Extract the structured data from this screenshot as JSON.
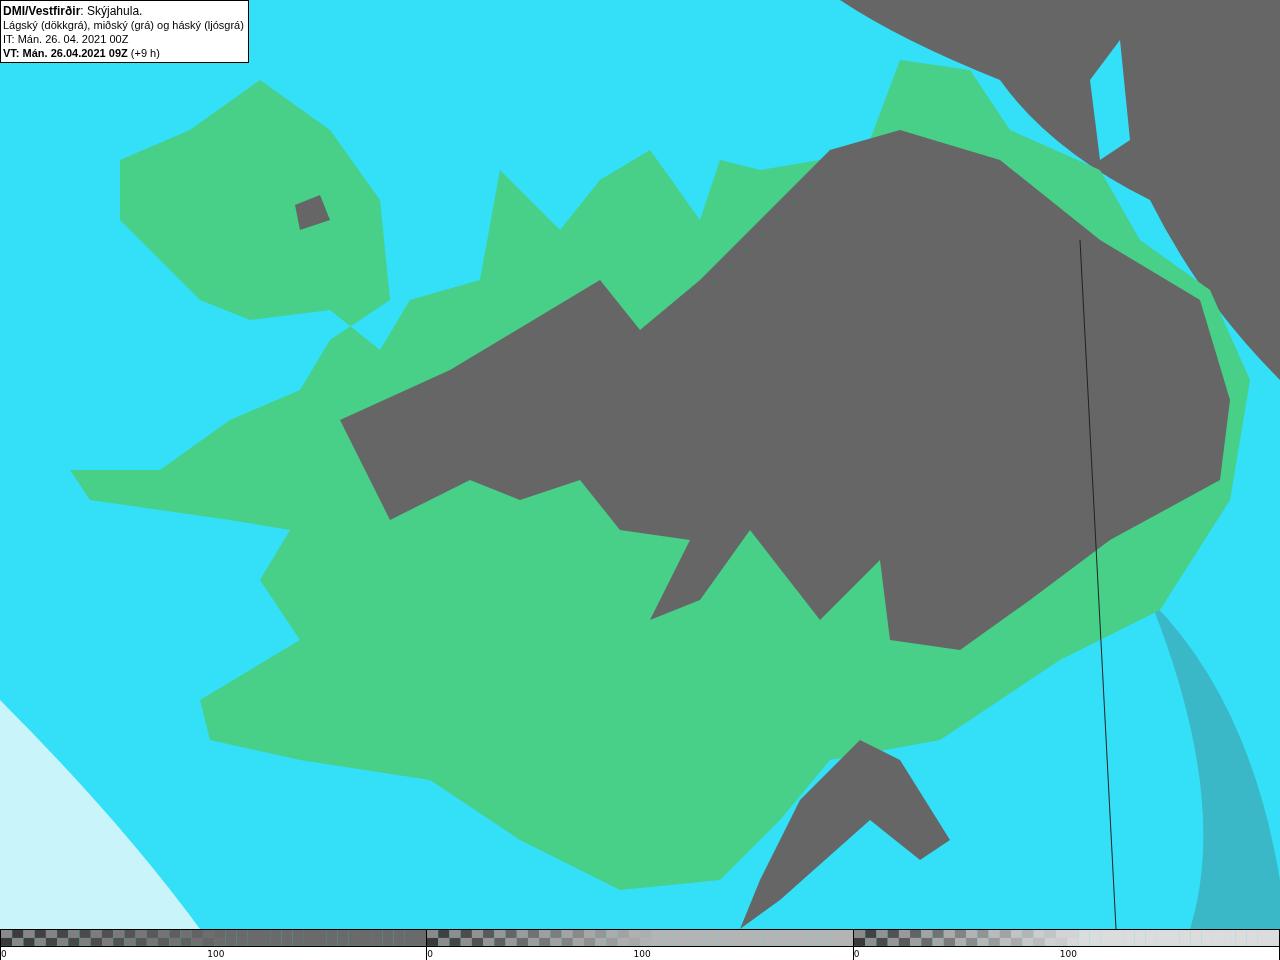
{
  "header": {
    "lines": [
      "**DMI/Vestfirðir**: Skýjahula.",
      "Lágský (dökkgrá), miðský (grá) og háský (ljósgrá)",
      "IT: Mán. 26. 04. 2021 00Z",
      "**VT: Mán. 26.04.2021 09Z** (+9 h)"
    ]
  },
  "legend": [
    {
      "color": "#6a6a6a",
      "ticks": [
        "0",
        "100"
      ]
    },
    {
      "color": "#b4b4b4",
      "ticks": [
        "0",
        "100"
      ]
    },
    {
      "color": "#dcdcdc",
      "ticks": [
        "0",
        "100"
      ]
    }
  ]
}
